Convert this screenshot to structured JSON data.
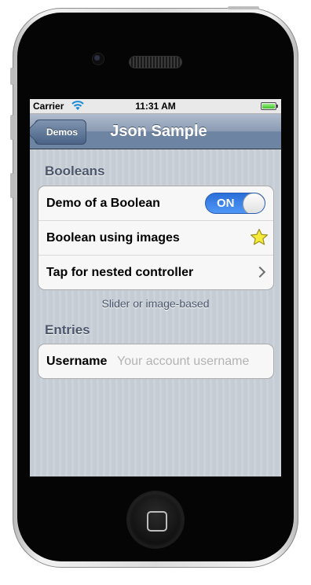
{
  "status_bar": {
    "carrier": "Carrier",
    "time": "11:31 AM",
    "battery_level": 1.0
  },
  "navbar": {
    "back_label": "Demos",
    "title": "Json Sample"
  },
  "booleans": {
    "header": "Booleans",
    "rows": [
      {
        "label": "Demo of a Boolean",
        "switch_text": "ON",
        "switch_on": true
      },
      {
        "label": "Boolean using images",
        "starred": true,
        "icon": "star-icon"
      },
      {
        "label": "Tap for nested controller",
        "icon": "chevron-right-icon"
      }
    ],
    "footer": "Slider or image-based"
  },
  "entries": {
    "header": "Entries",
    "username": {
      "label": "Username",
      "value": "",
      "placeholder": "Your account username"
    }
  },
  "colors": {
    "switch_on": "#2b6fda",
    "star_fill": "#f6ea3a",
    "navbar": "#6d84a2",
    "section_header": "#4c566c"
  }
}
